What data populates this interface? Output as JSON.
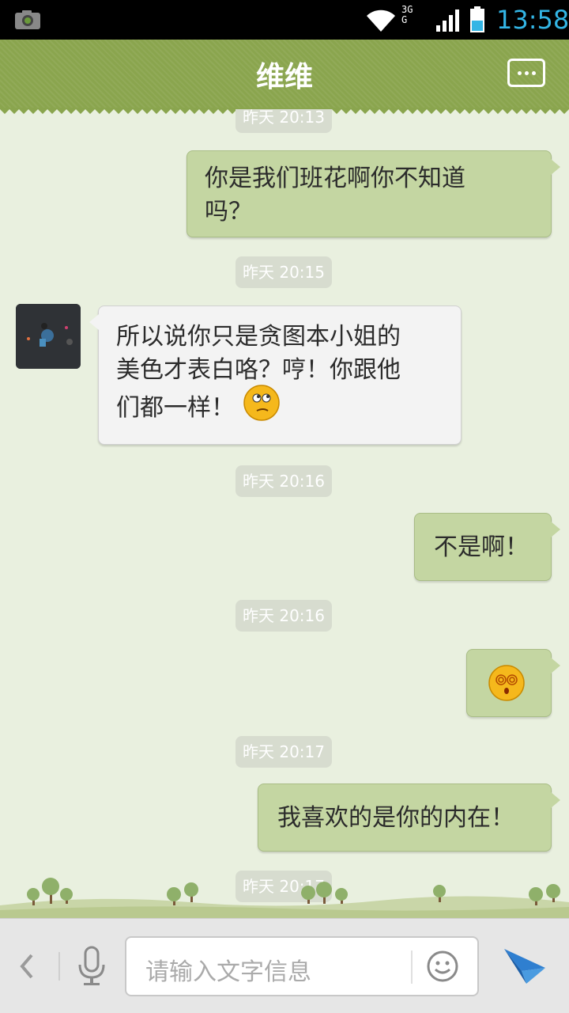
{
  "status_bar": {
    "time": "13:58",
    "network_label": "3G",
    "network_sub": "G",
    "colors": {
      "time": "#33b5e5",
      "background": "#000000"
    }
  },
  "title_bar": {
    "title": "维维",
    "menu_icon": "more-dots-icon",
    "colors": {
      "background": "#8aa54e"
    }
  },
  "messages": [
    {
      "type": "timestamp",
      "text": "昨天 20:13"
    },
    {
      "type": "sent",
      "lines": [
        "你是我们班花啊你不知道",
        "吗？"
      ]
    },
    {
      "type": "timestamp",
      "text": "昨天 20:15"
    },
    {
      "type": "received",
      "lines": [
        "所以说你只是贪图本小姐的",
        "美色才表白咯？哼！你跟他",
        "们都一样！"
      ],
      "emoji": "thinking-face-icon"
    },
    {
      "type": "timestamp",
      "text": "昨天 20:16"
    },
    {
      "type": "sent",
      "lines": [
        "不是啊！"
      ]
    },
    {
      "type": "timestamp",
      "text": "昨天 20:16"
    },
    {
      "type": "sent",
      "emoji": "dizzy-face-icon"
    },
    {
      "type": "timestamp",
      "text": "昨天 20:17"
    },
    {
      "type": "sent",
      "lines": [
        "我喜欢的是你的内在！"
      ]
    },
    {
      "type": "timestamp",
      "text": "昨天 20:17"
    }
  ],
  "input_bar": {
    "placeholder": "请输入文字信息",
    "back_icon": "chevron-left-icon",
    "voice_icon": "microphone-icon",
    "emoji_icon": "smiley-icon",
    "send_icon": "send-arrow-icon"
  },
  "colors": {
    "chat_background": "#e9f0df",
    "sent_bubble": "#c4d6a2",
    "received_bubble": "#f3f3f3"
  }
}
